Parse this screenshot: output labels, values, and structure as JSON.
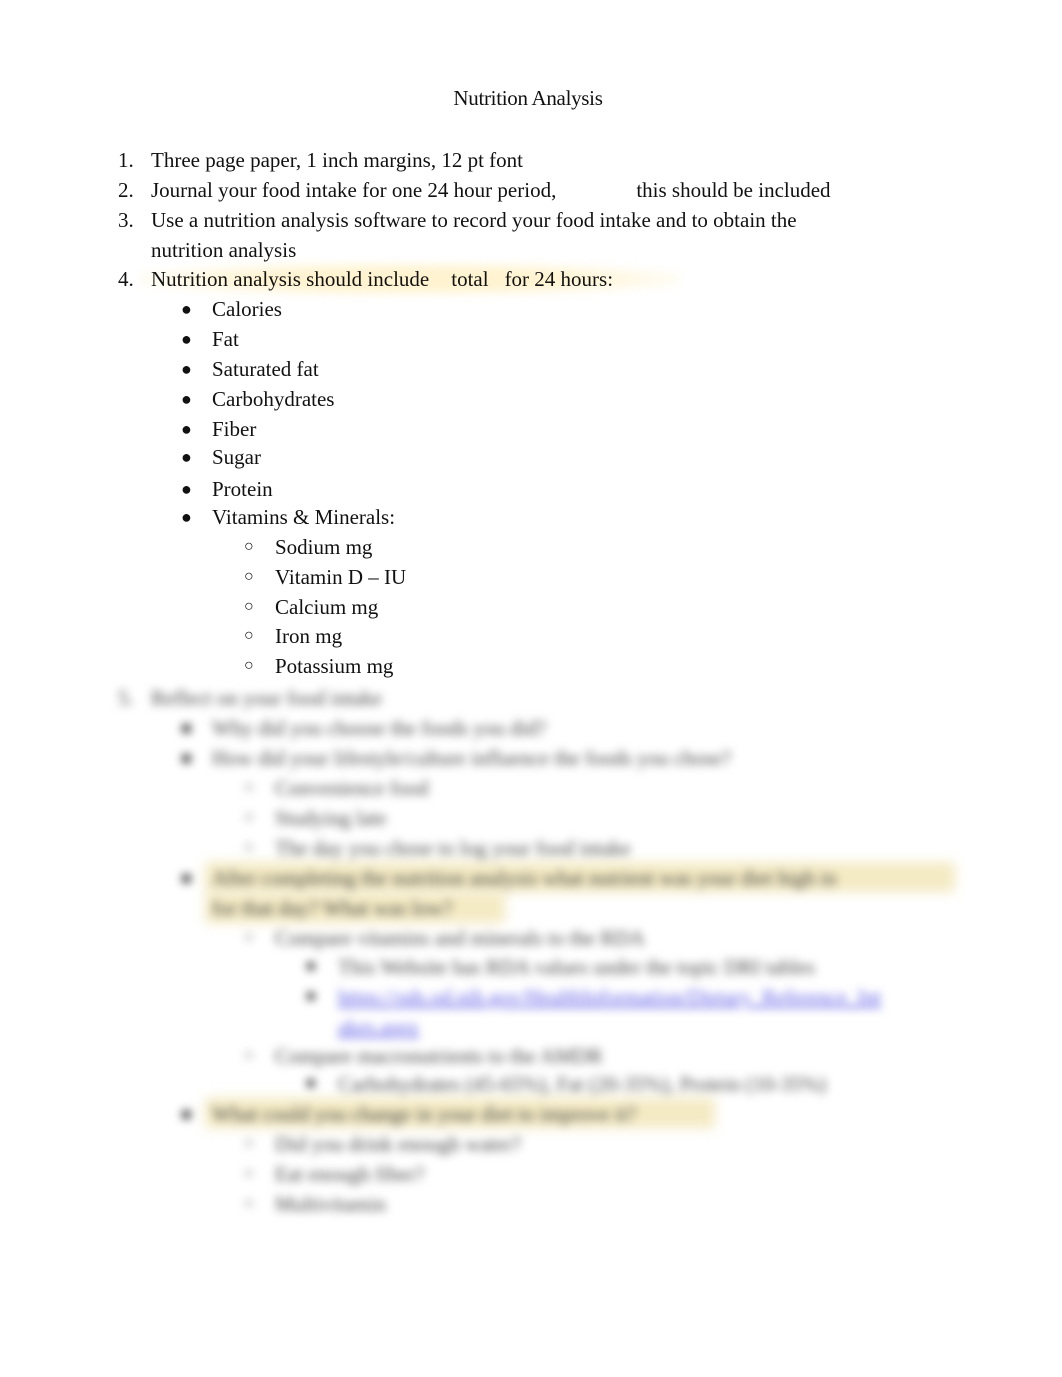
{
  "title": "Nutrition Analysis",
  "items": [
    {
      "num": "1.",
      "text": "Three page paper, 1 inch margins, 12 pt font"
    },
    {
      "num": "2.",
      "text_a": "Journal your food intake for one 24 hour period,",
      "text_b": "this should be included"
    },
    {
      "num": "3.",
      "text": "Use a nutrition analysis software to record your food intake and to obtain the",
      "text_cont": "nutrition analysis"
    },
    {
      "num": "4.",
      "text_a": "Nutrition analysis should include",
      "text_b": "total",
      "text_c": "for 24 hours:"
    }
  ],
  "bullets": [
    "Calories",
    "Fat",
    "Saturated fat",
    "Carbohydrates",
    "Fiber",
    "Sugar",
    "Protein",
    "Vitamins & Minerals:"
  ],
  "sub_bullets": [
    "Sodium mg",
    "Vitamin D – IU",
    "Calcium mg",
    "Iron mg",
    "Potassium mg"
  ],
  "glyphs": {
    "bullet": "●",
    "circle": "○",
    "square": "■"
  },
  "blurred": {
    "item5": {
      "num": "5.",
      "text": "Reflect on your food intake"
    },
    "q1": "Why did you choose the foods you did?",
    "q2": "How did your lifestyle/culture influence the foods you chose?",
    "q2_subs": [
      "Convenience food",
      "Studying late",
      "The day you chose to log your food intake"
    ],
    "q3_line1": "After completing the nutrition analysis what nutrient was your diet high in",
    "q3_line2": "for that day? What was low?",
    "q3_sub1": "Compare vitamins and minerals to the      RDA",
    "q3_sub1_items": [
      "This Website has RDA values under the topic DRI tables"
    ],
    "q3_link_1": "https://ods.od.nih.gov/HealthInformation/Dietary_Reference_Int",
    "q3_link_2": "akes.aspx",
    "q3_sub2": "Compare macronutrients to the      AMDR",
    "q3_sub2_items": [
      "Carbohydrates (45-65%), Fat (20-35%), Protein (10-35%)"
    ],
    "q4": "What could you change in your diet to improve it?",
    "q4_subs": [
      "Did you drink enough water?",
      "Eat enough fiber?",
      "Multivitamin"
    ]
  }
}
